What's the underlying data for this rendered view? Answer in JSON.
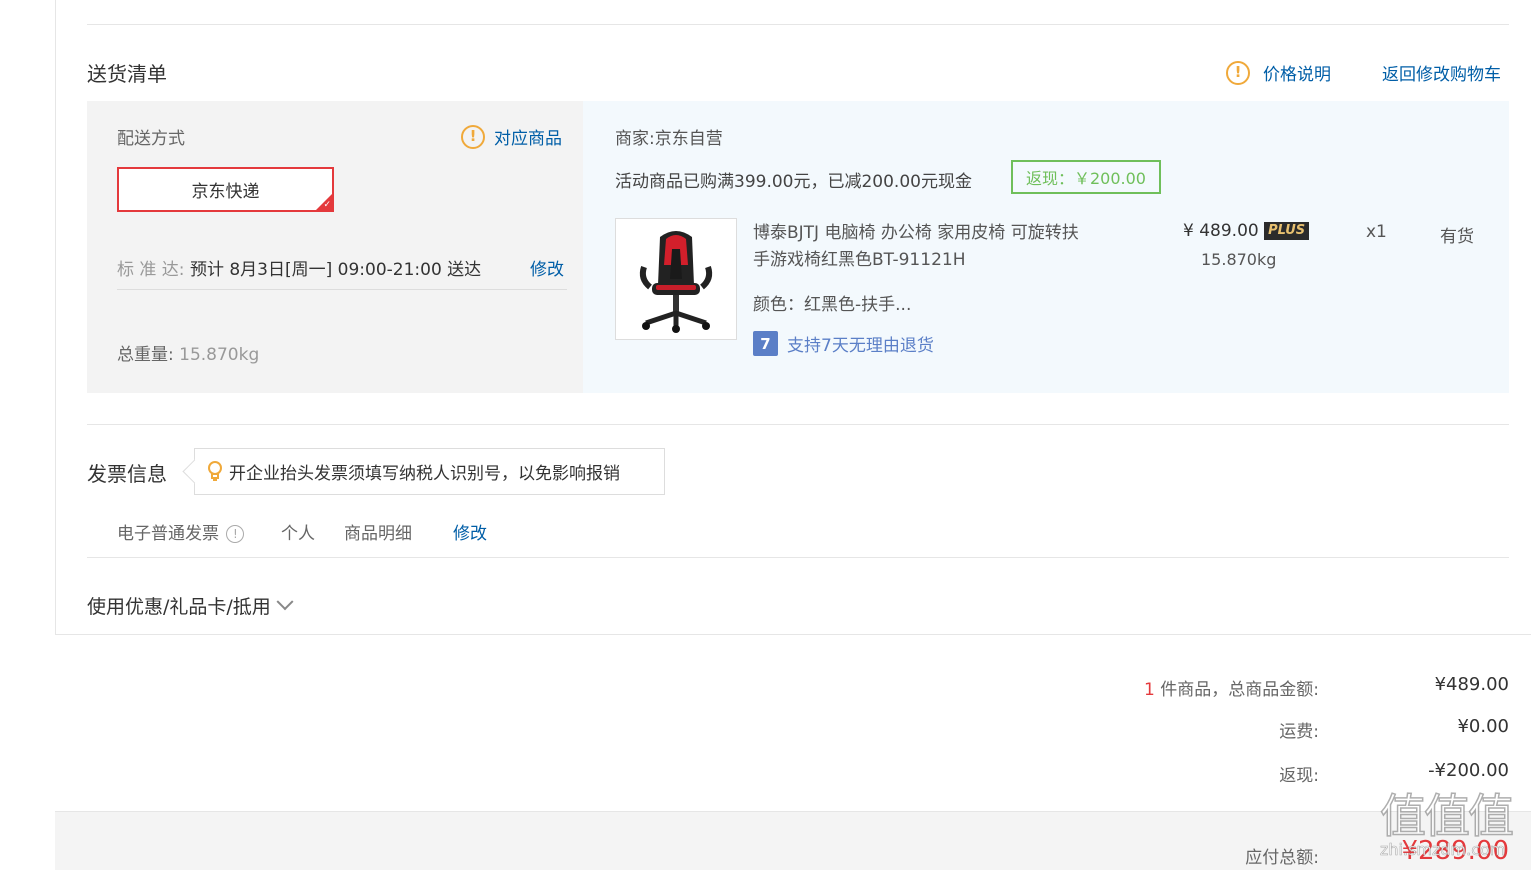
{
  "delivery": {
    "title": "送货清单",
    "price_note": "价格说明",
    "back_to_cart": "返回修改购物车",
    "method_label": "配送方式",
    "match_goods": "对应商品",
    "method_selected": "京东快递",
    "standard_label": "标 准 达:",
    "standard_text": "预计 8月3日[周一] 09:00-21:00 送达",
    "modify": "修改",
    "weight_label": "总重量:",
    "weight_value": "15.870kg"
  },
  "order": {
    "merchant_label": "商家:",
    "merchant": "京东自营",
    "promo_text": "活动商品已购满399.00元，已减200.00元现金",
    "cashback_tag": "返现：￥200.00",
    "product": {
      "title_line1": "博泰BJTJ 电脑椅 办公椅 家用皮椅 可旋转扶",
      "title_line2": "手游戏椅红黑色BT-91121H",
      "color": "颜色：红黑色-扶手...",
      "price": "¥ 489.00",
      "plus": "PLUS",
      "weight": "15.870kg",
      "qty": "x1",
      "stock": "有货",
      "return_policy": "支持7天无理由退货",
      "return_icon": "7"
    }
  },
  "invoice": {
    "title": "发票信息",
    "tip": "开企业抬头发票须填写纳税人识别号，以免影响报销",
    "type": "电子普通发票",
    "personal": "个人",
    "detail": "商品明细",
    "modify": "修改"
  },
  "coupons": {
    "label": "使用优惠/礼品卡/抵用"
  },
  "summary": {
    "count": "1",
    "goods_label": "件商品，总商品金额:",
    "goods_value": "¥489.00",
    "shipping_label": "运费:",
    "shipping_value": "¥0.00",
    "cashback_label": "返现:",
    "cashback_value": "-¥200.00",
    "total_label": "应付总额:",
    "total_value": "¥289.00"
  },
  "watermark": {
    "text": "值值值",
    "sub": "zhi.smzdm.com"
  },
  "colors": {
    "accent_red": "#e4393c",
    "link_blue": "#005ea7",
    "cashback_green": "#6fbf5a",
    "warn_orange": "#f0a93a"
  }
}
